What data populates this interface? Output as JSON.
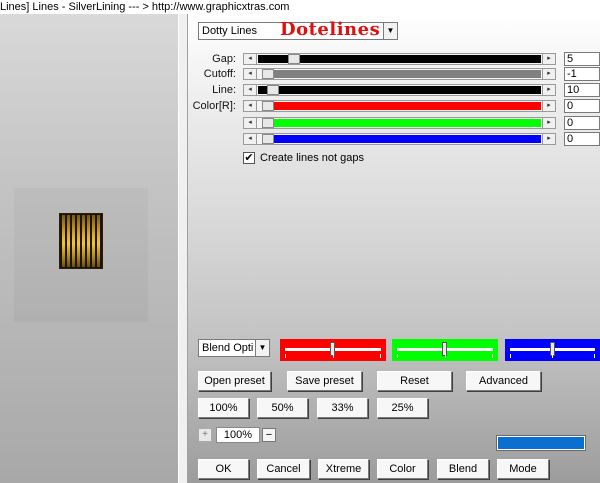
{
  "window": {
    "title": "Lines]  Lines - SilverLining     --- > http://www.graphicxtras.com"
  },
  "preset_select": {
    "value": "Dotty Lines"
  },
  "filter_name": "Dotelines",
  "controls": [
    {
      "label": "Gap:",
      "value": "5",
      "fraction": 0.1,
      "fill": "#000000"
    },
    {
      "label": "Cutoff:",
      "value": "-1",
      "fraction": 0.0,
      "fill": "#808080"
    },
    {
      "label": "Line:",
      "value": "10",
      "fraction": 0.02,
      "fill": "#000000"
    },
    {
      "label": "Color[R]:",
      "value": "0",
      "fraction": 0.0,
      "fill": "#ff0000"
    },
    {
      "label": "",
      "value": "0",
      "fraction": 0.0,
      "fill": "#00ff00"
    },
    {
      "label": "",
      "value": "0",
      "fraction": 0.0,
      "fill": "#0000ff"
    }
  ],
  "checkbox": {
    "label": "Create lines not gaps",
    "checked": true
  },
  "blend_select": {
    "value": "Blend Opti"
  },
  "color_sliders": [
    {
      "color": "#ff0000",
      "level": 0.5
    },
    {
      "color": "#00ff00",
      "level": 0.5
    },
    {
      "color": "#0000ff",
      "level": 0.5
    }
  ],
  "buttons": {
    "open_preset": "Open preset",
    "save_preset": "Save preset",
    "reset": "Reset",
    "advanced": "Advanced",
    "z100": "100%",
    "z50": "50%",
    "z33": "33%",
    "z25": "25%",
    "ok": "OK",
    "cancel": "Cancel",
    "xtreme": "Xtreme",
    "color": "Color",
    "blend": "Blend",
    "mode": "Mode"
  },
  "zoom": {
    "plus": "+",
    "value": "100%",
    "minus": "−"
  },
  "icons": {
    "arrow_left": "left-arrow-icon",
    "arrow_right": "right-arrow-icon",
    "dropdown": "chevron-down-icon",
    "check": "check-icon"
  },
  "colors": {
    "filter_name": "#e01010",
    "blue_swatch": "#0a6fd0"
  }
}
